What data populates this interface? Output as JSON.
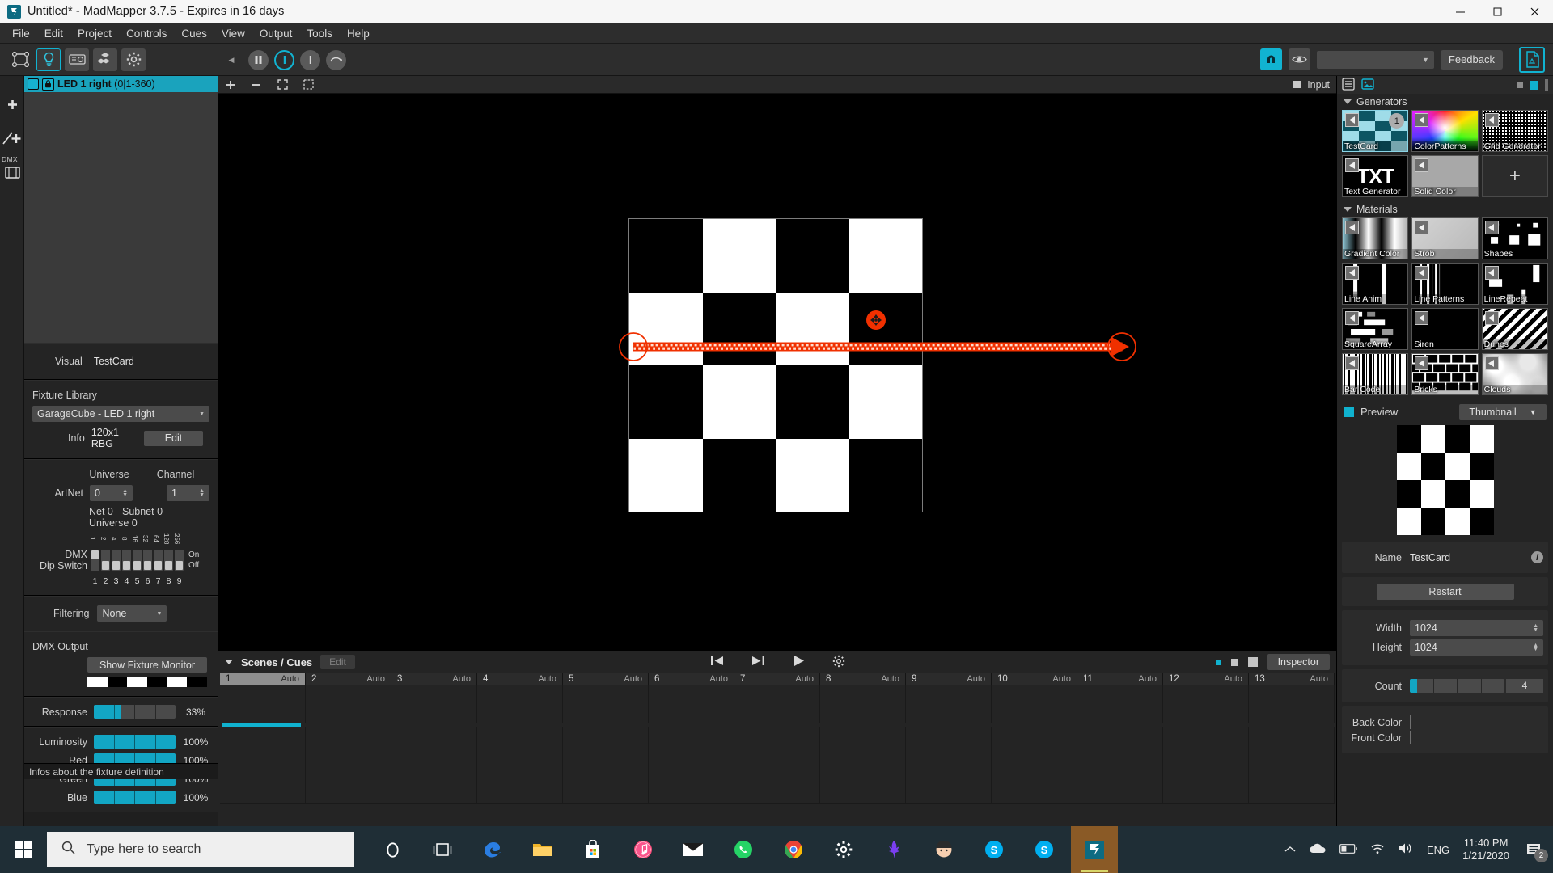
{
  "window": {
    "title": "Untitled* - MadMapper 3.7.5 - Expires in 16 days",
    "minimize": "minimize-icon",
    "maximize": "maximize-icon",
    "close": "close-icon"
  },
  "menu": [
    "File",
    "Edit",
    "Project",
    "Controls",
    "Cues",
    "View",
    "Output",
    "Tools",
    "Help"
  ],
  "toolbar": {
    "tools": [
      "surfaces-icon",
      "fixture-icon",
      "media-icon",
      "modules-icon",
      "preferences-icon"
    ],
    "collapse": "collapse-arrow-icon",
    "transport": [
      "pause-icon",
      "bypass-icon",
      "solo-icon",
      "reset-icon"
    ],
    "snap": "magnet-icon",
    "preview_eye": "eye-icon",
    "combo_value": "",
    "feedback_label": "Feedback",
    "doc": "document-icon"
  },
  "left_rail": {
    "dmx_label": "DMX",
    "items": [
      "add-dmx-fixture-icon",
      "add-line-fixture-icon",
      "add-media-icon"
    ]
  },
  "fixtures": {
    "rows": [
      {
        "name": "LED 1 right",
        "range": "(0|1-360)",
        "checked": true,
        "locked": true
      }
    ]
  },
  "fixture_props": {
    "visual_label": "Visual",
    "visual_value": "TestCard",
    "library_label": "Fixture Library",
    "library_value": "GarageCube - LED 1 right",
    "info_label": "Info",
    "info_value": "120x1 RBG",
    "edit_label": "Edit",
    "universe_label": "Universe",
    "channel_label": "Channel",
    "artnet_label": "ArtNet",
    "universe_value": "0",
    "channel_value": "1",
    "net_info": "Net 0 - Subnet 0 - Universe 0",
    "dip_label_1": "DMX",
    "dip_label_2": "Dip Switch",
    "dip_on": "On",
    "dip_off": "Off",
    "dip_weights": [
      "1",
      "2",
      "4",
      "8",
      "16",
      "32",
      "64",
      "128",
      "256"
    ],
    "dip_numbers": [
      "1",
      "2",
      "3",
      "4",
      "5",
      "6",
      "7",
      "8",
      "9"
    ],
    "dip_states": [
      "on",
      "off",
      "off",
      "off",
      "off",
      "off",
      "off",
      "off",
      "off"
    ],
    "filtering_label": "Filtering",
    "filtering_value": "None",
    "dmx_output_label": "DMX Output",
    "show_monitor_label": "Show Fixture Monitor",
    "sliders": [
      {
        "label": "Response",
        "value": "33%",
        "pct": 33
      },
      {
        "label": "Luminosity",
        "value": "100%",
        "pct": 100
      },
      {
        "label": "Red",
        "value": "100%",
        "pct": 100
      },
      {
        "label": "Green",
        "value": "100%",
        "pct": 100
      },
      {
        "label": "Blue",
        "value": "100%",
        "pct": 100
      }
    ],
    "status": "Infos about the fixture definition"
  },
  "canvas": {
    "toolbar_icons": [
      "add-icon",
      "remove-icon",
      "fit-icon",
      "select-icon"
    ],
    "input_label": "Input",
    "input_icon": "square-icon",
    "led_fixture": {
      "name": "LED 1 right",
      "handle": "move-handle-icon",
      "direction": "arrow-right-icon"
    }
  },
  "cues": {
    "title": "Scenes / Cues",
    "edit_label": "Edit",
    "transport": [
      "go-back-icon",
      "go-forward-icon",
      "play-icon",
      "settings-icon"
    ],
    "view_modes": [
      "view-small-icon",
      "view-medium-icon",
      "view-large-icon"
    ],
    "inspector_label": "Inspector",
    "auto_label": "Auto",
    "cells": [
      "1",
      "2",
      "3",
      "4",
      "5",
      "6",
      "7",
      "8",
      "9",
      "10",
      "11",
      "12",
      "13"
    ],
    "selected_index": 0
  },
  "right_panel": {
    "tabs": [
      "list-view-icon",
      "thumbnail-view-icon"
    ],
    "generators": {
      "title": "Generators",
      "items": [
        {
          "label": "TestCard",
          "thumb": "testcard",
          "selected": true,
          "badge": "1"
        },
        {
          "label": "ColorPatterns",
          "thumb": "colorwheel"
        },
        {
          "label": "Grid Generator",
          "thumb": "grid"
        },
        {
          "label": "Text Generator",
          "thumb": "txt"
        },
        {
          "label": "Solid Color",
          "thumb": "solid"
        },
        {
          "label": "",
          "thumb": "plus"
        }
      ]
    },
    "materials": {
      "title": "Materials",
      "items": [
        {
          "label": "Gradient Color",
          "thumb": "gradient"
        },
        {
          "label": "Strob",
          "thumb": "strob"
        },
        {
          "label": "Shapes",
          "thumb": "shapes"
        },
        {
          "label": "Line Anim",
          "thumb": "lineanim"
        },
        {
          "label": "Line Patterns",
          "thumb": "linepatterns"
        },
        {
          "label": "LineRepeat",
          "thumb": "linerepeat"
        },
        {
          "label": "SquareArray",
          "thumb": "squarearray"
        },
        {
          "label": "Siren",
          "thumb": "siren"
        },
        {
          "label": "Dunes",
          "thumb": "dunes"
        },
        {
          "label": "Bar Code",
          "thumb": "barcode"
        },
        {
          "label": "Bricks",
          "thumb": "bricks"
        },
        {
          "label": "Clouds",
          "thumb": "clouds"
        }
      ]
    },
    "preview": {
      "label": "Preview",
      "mode": "Thumbnail"
    },
    "properties": {
      "name_label": "Name",
      "name_value": "TestCard",
      "info_icon": "info-icon",
      "restart_label": "Restart",
      "width_label": "Width",
      "width_value": "1024",
      "height_label": "Height",
      "height_value": "1024",
      "count_label": "Count",
      "count_value": "4",
      "count_pct": 8,
      "back_color_label": "Back Color",
      "back_color": "#000000",
      "front_color_label": "Front Color",
      "front_color": "#ffffff"
    }
  },
  "taskbar": {
    "start": "windows-start-icon",
    "search_placeholder": "Type here to search",
    "search_icon": "search-icon",
    "apps": [
      "cortana-icon",
      "task-view-icon",
      "edge-icon",
      "file-explorer-icon",
      "microsoft-store-icon",
      "itunes-icon",
      "mail-icon",
      "whatsapp-icon",
      "chrome-icon",
      "settings-icon",
      "bird-icon",
      "emoji-icon",
      "skype-icon",
      "skype-business-icon",
      "madmapper-icon"
    ],
    "tray": [
      "chevron-up-icon",
      "onedrive-icon",
      "battery-icon",
      "wifi-icon",
      "volume-icon"
    ],
    "language": "ENG",
    "time": "11:40 PM",
    "date": "1/21/2020",
    "notifications": "2"
  },
  "colors": {
    "accent": "#10b2cf",
    "highlight": "#1aa3bd",
    "led_red": "#f03000",
    "panel": "#242424",
    "taskbar": "#1f2e36"
  }
}
